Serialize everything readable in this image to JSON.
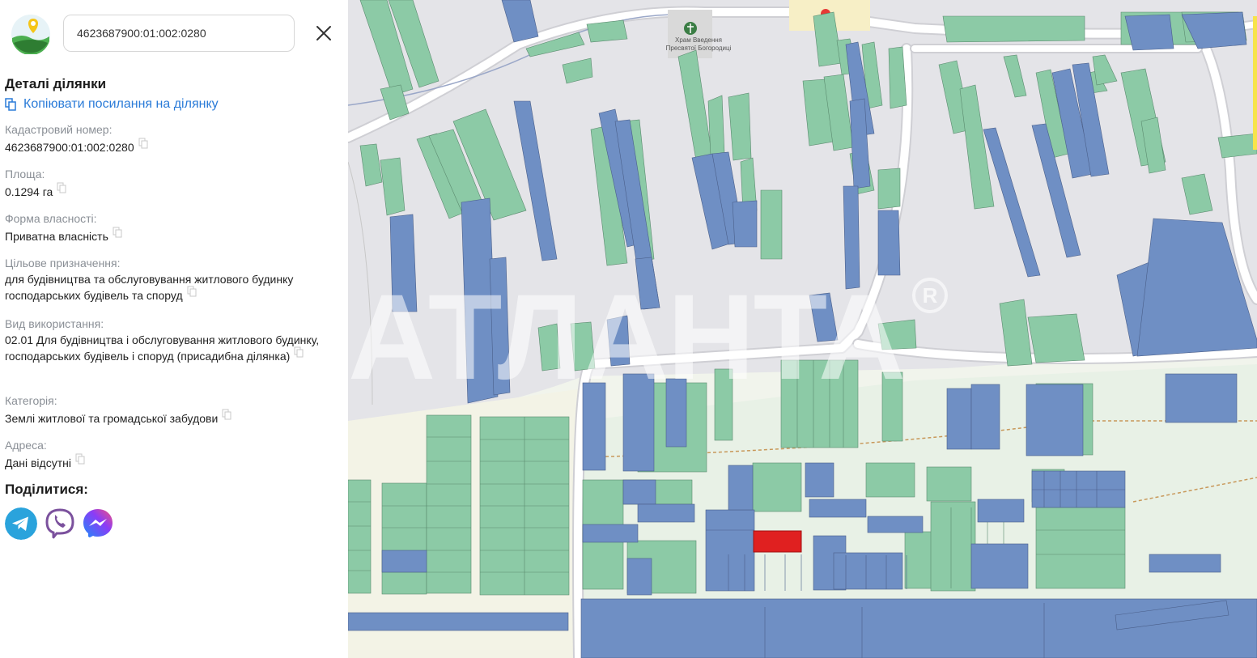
{
  "search": {
    "value": "4623687900:01:002:0280"
  },
  "details": {
    "title": "Деталі ділянки",
    "copy_link": "Копіювати посилання на ділянку",
    "fields": [
      {
        "label": "Кадастровий номер:",
        "value": "4623687900:01:002:0280"
      },
      {
        "label": "Площа:",
        "value": "0.1294 га"
      },
      {
        "label": "Форма власності:",
        "value": "Приватна власність"
      },
      {
        "label": "Цільове призначення:",
        "value": "для будівництва та обслуговування житлового будинку господарських будівель та споруд"
      },
      {
        "label": "Вид використання:",
        "value": "02.01 Для будівництва і обслуговування житлового будинку, господарських будівель і споруд (присадибна ділянка)"
      },
      {
        "label": "Категорія:",
        "value": "Землі житлової та громадської забудови"
      },
      {
        "label": "Адреса:",
        "value": "Дані відсутні"
      }
    ]
  },
  "share": {
    "title": "Поділитися:",
    "buttons": [
      {
        "name": "telegram",
        "color": "#2aa3dc"
      },
      {
        "name": "viber",
        "color": "#7b519d"
      },
      {
        "name": "messenger",
        "color": "#1d8cf8"
      }
    ]
  },
  "map": {
    "church_label": "Храм Введення Пресвятої Богородиці",
    "watermark": "АТЛАНТА",
    "colors": {
      "green": "#8ccaa6",
      "blue": "#6f8fc4",
      "selected": "#e02020",
      "road": "#ffffff",
      "bg": "#e4e4e8"
    }
  }
}
